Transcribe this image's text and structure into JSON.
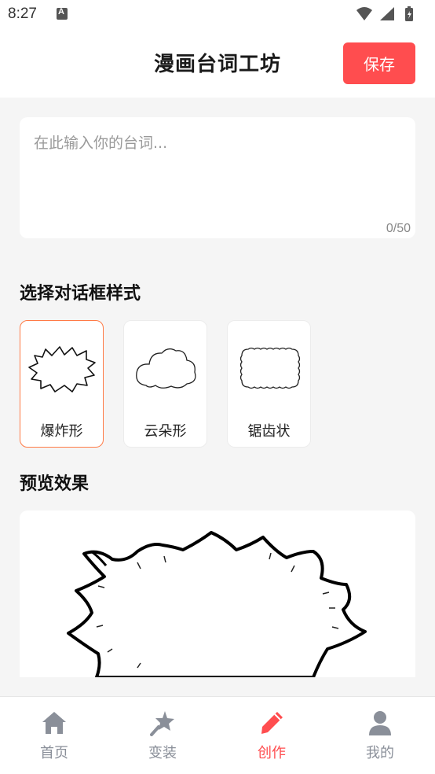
{
  "status_bar": {
    "time": "8:27"
  },
  "header": {
    "title": "漫画台词工坊",
    "save_label": "保存"
  },
  "editor": {
    "placeholder": "在此输入你的台词...",
    "value": "",
    "counter": "0/50"
  },
  "style_section": {
    "title": "选择对话框样式",
    "options": [
      {
        "label": "爆炸形",
        "icon": "explosion-bubble-icon",
        "selected": true
      },
      {
        "label": "云朵形",
        "icon": "cloud-bubble-icon",
        "selected": false
      },
      {
        "label": "锯齿状",
        "icon": "jagged-bubble-icon",
        "selected": false
      }
    ]
  },
  "preview_section": {
    "title": "预览效果"
  },
  "bottom_nav": {
    "items": [
      {
        "label": "首页",
        "icon": "home-icon",
        "active": false
      },
      {
        "label": "变装",
        "icon": "magic-star-icon",
        "active": false
      },
      {
        "label": "创作",
        "icon": "pencil-icon",
        "active": true
      },
      {
        "label": "我的",
        "icon": "person-icon",
        "active": false
      }
    ]
  },
  "colors": {
    "accent": "#ff4d4f",
    "selected_border": "#ff7a45",
    "inactive_nav": "#8a8f99",
    "background": "#f5f5f5"
  }
}
